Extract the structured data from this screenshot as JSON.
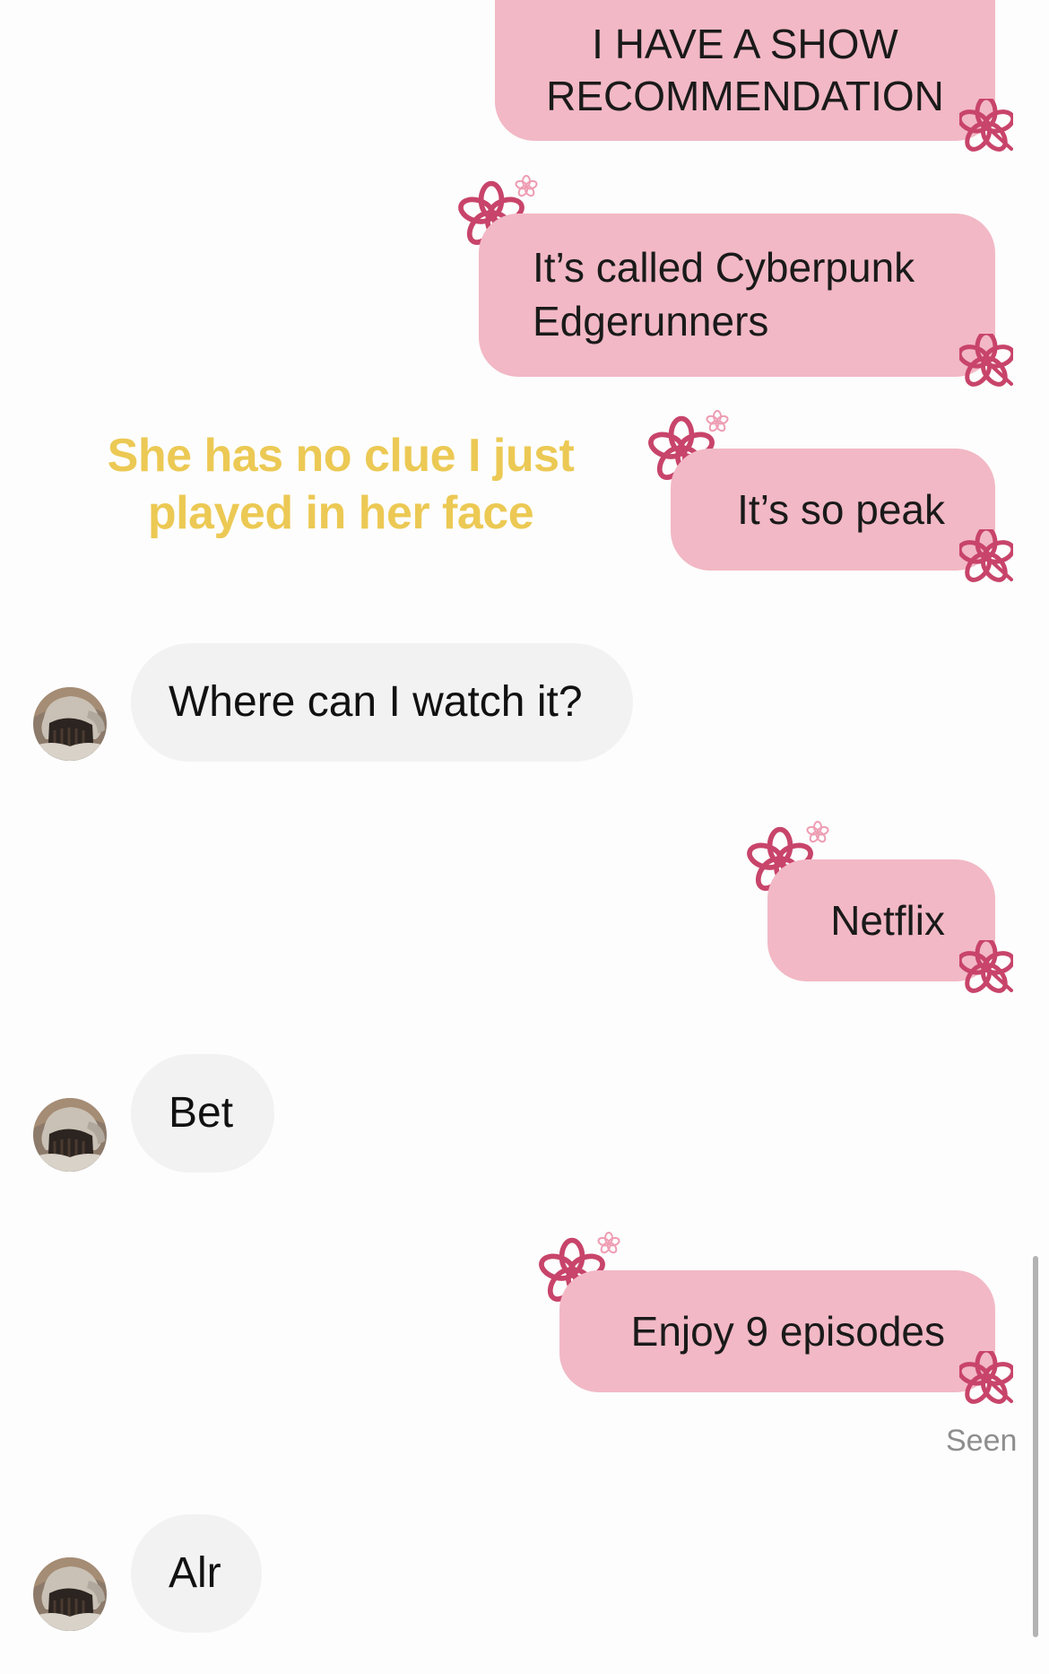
{
  "messages": {
    "out1": {
      "line1": "I HAVE A SHOW",
      "line2": "RECOMMENDATION"
    },
    "out2": {
      "line1": "It’s called Cyberpunk",
      "line2": "Edgerunners"
    },
    "out3": {
      "text": "It’s so peak"
    },
    "in1": {
      "text": "Where can I watch it?"
    },
    "out4": {
      "text": "Netflix"
    },
    "in2": {
      "text": "Bet"
    },
    "out5": {
      "text": "Enjoy 9 episodes"
    },
    "in3": {
      "text": "Alr"
    }
  },
  "caption": {
    "line1": "She has no clue I just",
    "line2": "played in her face"
  },
  "status": {
    "seen": "Seen"
  },
  "colors": {
    "outgoing_bubble": "#f2b8c5",
    "incoming_bubble": "#f2f2f2",
    "caption": "#ecc954",
    "flower": "#c8446a"
  },
  "icons": {
    "bubble_decoration": "pink-flower-icon",
    "sender_avatar": "avatar"
  }
}
